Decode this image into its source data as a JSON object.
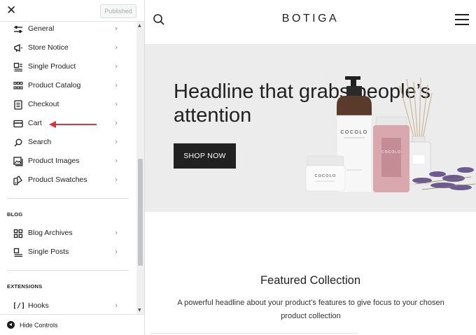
{
  "panel": {
    "close_glyph": "✕",
    "publish_label": "Published",
    "items": [
      {
        "label": "General",
        "icon": "sliders-icon"
      },
      {
        "label": "Store Notice",
        "icon": "megaphone-icon"
      },
      {
        "label": "Single Product",
        "icon": "single-product-icon"
      },
      {
        "label": "Product Catalog",
        "icon": "catalog-grid-icon"
      },
      {
        "label": "Checkout",
        "icon": "checkout-list-icon"
      },
      {
        "label": "Cart",
        "icon": "card-icon"
      },
      {
        "label": "Search",
        "icon": "search-icon"
      },
      {
        "label": "Product Images",
        "icon": "images-icon"
      },
      {
        "label": "Product Swatches",
        "icon": "swatches-icon"
      }
    ],
    "blog": {
      "title": "BLOG",
      "items": [
        {
          "label": "Blog Archives",
          "icon": "grid-icon"
        },
        {
          "label": "Single Posts",
          "icon": "single-post-icon"
        }
      ]
    },
    "extensions": {
      "title": "EXTENSIONS",
      "items": [
        {
          "label": "Hooks",
          "icon": "hooks-icon",
          "glyph": "[/]"
        }
      ]
    },
    "hide_controls_label": "Hide Controls",
    "annotation_color": "#d63638"
  },
  "preview": {
    "logo": "BOTIGA",
    "hero": {
      "headline": "Headline that grabs people’s attention",
      "button_label": "SHOP NOW",
      "product_brand": "COCOLO",
      "background": "#ececec"
    },
    "featured": {
      "title": "Featured Collection",
      "subtitle": "A powerful headline about your product’s features to give focus to your chosen product collection"
    }
  }
}
